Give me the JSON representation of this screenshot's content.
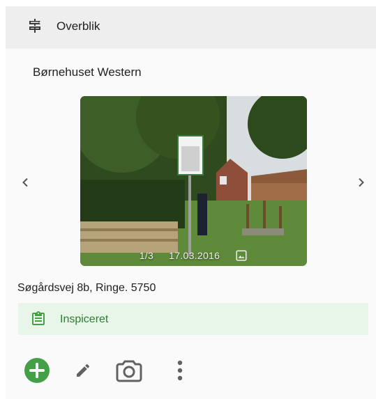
{
  "header": {
    "title": "Overblik",
    "icon": "signpost-icon"
  },
  "site": {
    "name": "Børnehuset Western",
    "address": "Søgårdsvej 8b, Ringe. 5750"
  },
  "carousel": {
    "counter": "1/3",
    "date": "17.03.2016",
    "prev_icon": "chevron-left-icon",
    "next_icon": "chevron-right-icon",
    "gallery_icon": "image-icon"
  },
  "status": {
    "label": "Inspiceret",
    "icon": "clipboard-text-icon",
    "color": "#2e7d32",
    "background": "#e8f5e9"
  },
  "actions": {
    "add_icon": "plus-circle-icon",
    "edit_icon": "pencil-icon",
    "camera_icon": "camera-icon",
    "more_icon": "more-vertical-icon",
    "accent": "#43a047"
  }
}
